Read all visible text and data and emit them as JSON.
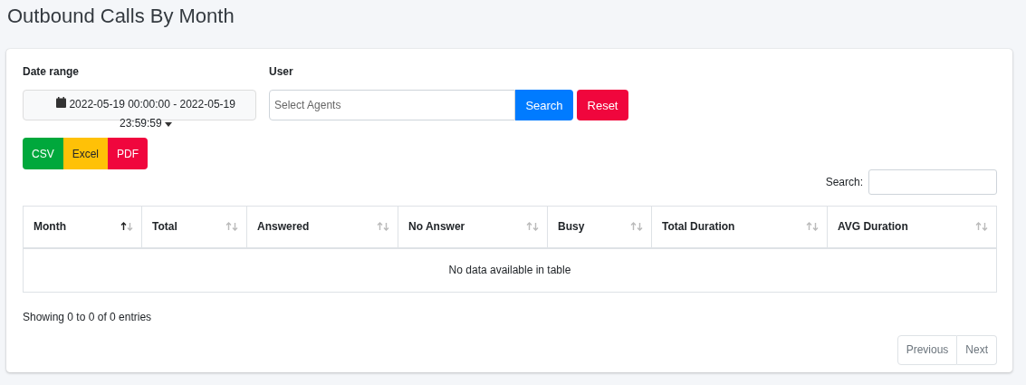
{
  "title": "Outbound Calls By Month",
  "filters": {
    "date_label": "Date range",
    "date_value": "2022-05-19 00:00:00 - 2022-05-19 23:59:59",
    "user_label": "User",
    "user_placeholder": "Select Agents",
    "search_button": "Search",
    "reset_button": "Reset"
  },
  "export_buttons": [
    {
      "label": "CSV",
      "color": "#00a83c"
    },
    {
      "label": "Excel",
      "color": "#ffc107"
    },
    {
      "label": "PDF",
      "color": "#f0063d"
    }
  ],
  "table_search_label": "Search:",
  "table": {
    "columns": [
      {
        "label": "Month",
        "sorted_ascending": true
      },
      {
        "label": "Total",
        "sorted_ascending": false
      },
      {
        "label": "Answered",
        "sorted_ascending": false
      },
      {
        "label": "No Answer",
        "sorted_ascending": false
      },
      {
        "label": "Busy",
        "sorted_ascending": false
      },
      {
        "label": "Total Duration",
        "sorted_ascending": false
      },
      {
        "label": "AVG Duration",
        "sorted_ascending": false
      }
    ],
    "empty_message": "No data available in table"
  },
  "info": "Showing 0 to 0 of 0 entries",
  "pagination": [
    {
      "label": "Previous",
      "disabled": true
    },
    {
      "label": "Next",
      "disabled": true
    }
  ]
}
